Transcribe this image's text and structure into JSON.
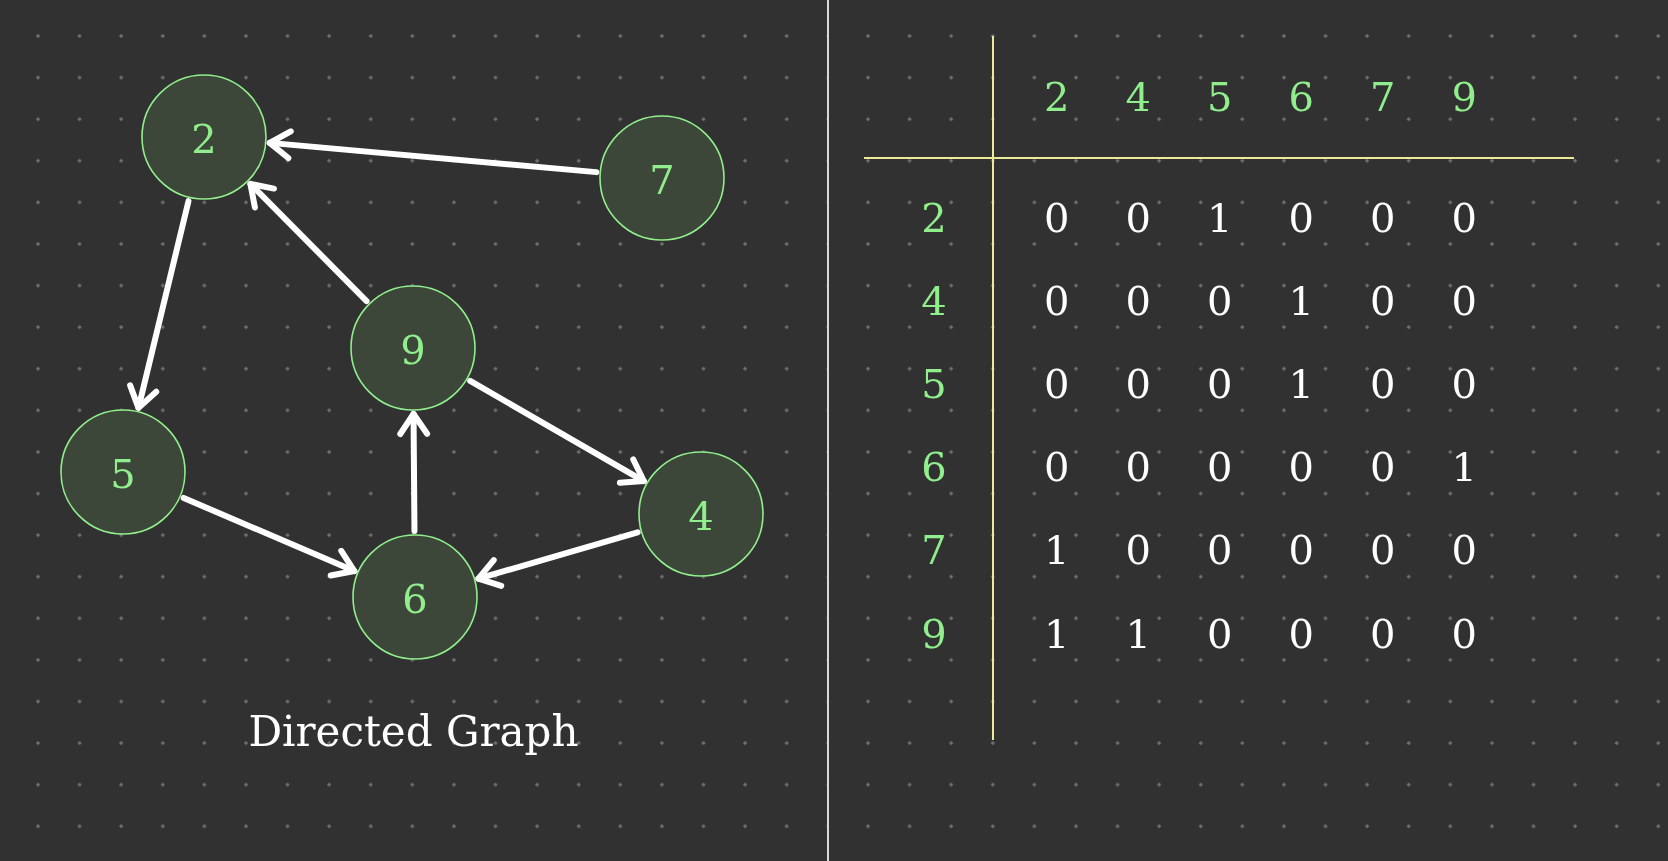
{
  "graph": {
    "nodes": [
      {
        "label": "2"
      },
      {
        "label": "7"
      },
      {
        "label": "9"
      },
      {
        "label": "5"
      },
      {
        "label": "4"
      },
      {
        "label": "6"
      }
    ],
    "caption": "Directed Graph"
  },
  "adjacency_matrix": {
    "columns": [
      "2",
      "4",
      "5",
      "6",
      "7",
      "9"
    ],
    "rows": [
      {
        "label": "2",
        "cells": [
          "0",
          "0",
          "1",
          "0",
          "0",
          "0"
        ]
      },
      {
        "label": "4",
        "cells": [
          "0",
          "0",
          "0",
          "1",
          "0",
          "0"
        ]
      },
      {
        "label": "5",
        "cells": [
          "0",
          "0",
          "0",
          "1",
          "0",
          "0"
        ]
      },
      {
        "label": "6",
        "cells": [
          "0",
          "0",
          "0",
          "0",
          "0",
          "1"
        ]
      },
      {
        "label": "7",
        "cells": [
          "1",
          "0",
          "0",
          "0",
          "0",
          "0"
        ]
      },
      {
        "label": "9",
        "cells": [
          "1",
          "1",
          "0",
          "0",
          "0",
          "0"
        ]
      }
    ]
  }
}
